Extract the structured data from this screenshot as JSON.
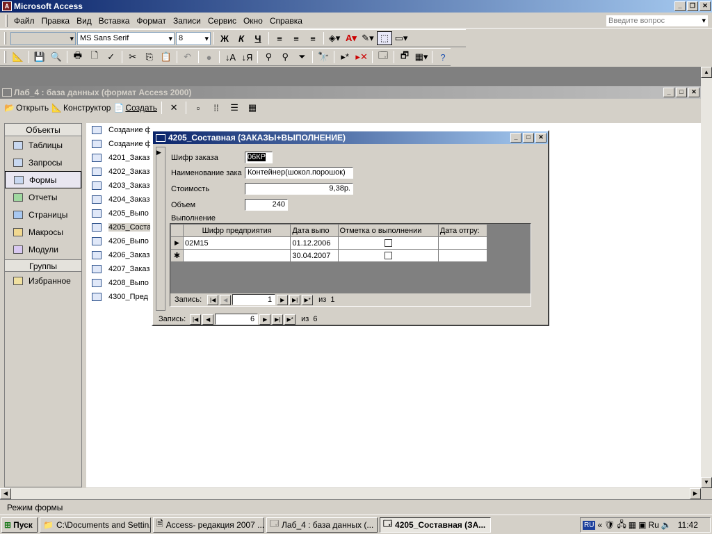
{
  "app": {
    "title": "Microsoft Access",
    "icon": "access-icon"
  },
  "menu": {
    "items": [
      "Файл",
      "Правка",
      "Вид",
      "Вставка",
      "Формат",
      "Записи",
      "Сервис",
      "Окно",
      "Справка"
    ],
    "help_placeholder": "Введите вопрос"
  },
  "toolbar1": {
    "object_box": "",
    "font": "MS Sans Serif",
    "size": "8",
    "bold": "Ж",
    "italic": "К",
    "underline": "Ч"
  },
  "dbwindow": {
    "title": "Лаб_4 : база данных (формат Access 2000)",
    "open": "Открыть",
    "design": "Конструктор",
    "create": "Создать"
  },
  "objects": {
    "header": "Объекты",
    "items": [
      "Таблицы",
      "Запросы",
      "Формы",
      "Отчеты",
      "Страницы",
      "Макросы",
      "Модули"
    ],
    "groups_header": "Группы",
    "groups": [
      "Избранное"
    ]
  },
  "object_list": [
    "Создание ф",
    "Создание ф",
    "4201_Заказ",
    "4202_Заказ",
    "4203_Заказ",
    "4204_Заказ",
    "4205_Выпо",
    "4205_Соста",
    "4206_Выпо",
    "4206_Заказ",
    "4207_Заказ",
    "4208_Выпо",
    "4300_Пред"
  ],
  "form": {
    "title": "4205_Составная (ЗАКАЗЫ+ВЫПОЛНЕНИЕ)",
    "fields": [
      {
        "label": "Шифр заказа",
        "value": "06КР"
      },
      {
        "label": "Наименование зака",
        "value": "Контейнер(шокол.порошок)"
      },
      {
        "label": "Стоимость",
        "value": "9,38р."
      },
      {
        "label": "Объем",
        "value": "240"
      }
    ],
    "subform_label": "Выполнение",
    "subform": {
      "headers": [
        "Шифр предприятия",
        "Дата выпо",
        "Отметка о выполнении",
        "Дата отгру:"
      ],
      "rows": [
        [
          "02М15",
          "01.12.2006",
          "",
          ""
        ],
        [
          "",
          "30.04.2007",
          "",
          ""
        ]
      ],
      "nav": {
        "label": "Запись:",
        "current": "1",
        "of": "из",
        "total": "1"
      }
    },
    "nav": {
      "label": "Запись:",
      "current": "6",
      "of": "из",
      "total": "6"
    }
  },
  "status": {
    "text": "Режим формы"
  },
  "taskbar": {
    "start": "Пуск",
    "tasks": [
      "C:\\Documents and Settin...",
      "Access- редакция 2007 ...",
      "Лаб_4 : база данных (...",
      "4205_Составная (ЗА..."
    ],
    "lang": "RU",
    "clock": "11:42"
  }
}
